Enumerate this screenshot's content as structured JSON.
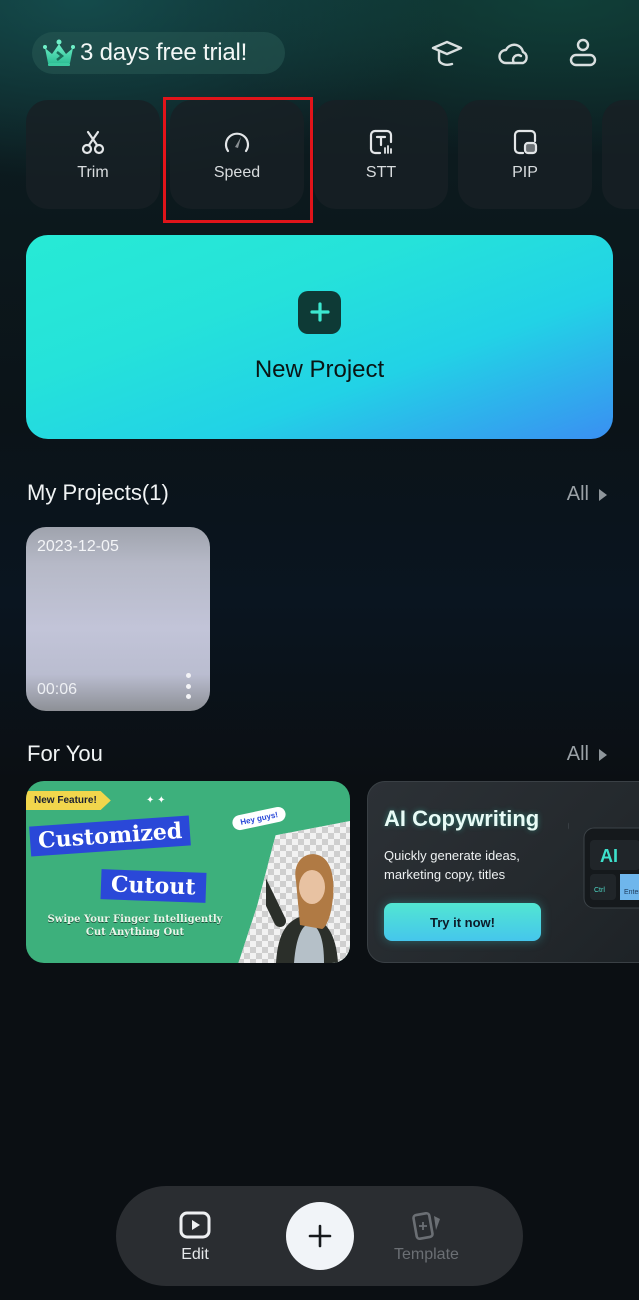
{
  "header": {
    "trial_label": "3 days free trial!",
    "icons": [
      "graduation-cap-icon",
      "cloud-icon",
      "user-icon"
    ]
  },
  "tools": [
    {
      "label": "Trim",
      "icon": "scissors-icon"
    },
    {
      "label": "Speed",
      "icon": "speedometer-icon",
      "highlighted": true
    },
    {
      "label": "STT",
      "icon": "speech-to-text-icon"
    },
    {
      "label": "PIP",
      "icon": "picture-in-picture-icon"
    }
  ],
  "new_project": {
    "label": "New Project",
    "icon": "plus-icon"
  },
  "my_projects": {
    "title": "My Projects(1)",
    "all_label": "All",
    "items": [
      {
        "date": "2023-12-05",
        "duration": "00:06"
      }
    ]
  },
  "for_you": {
    "title": "For You",
    "all_label": "All",
    "cards": [
      {
        "tag": "New Feature!",
        "title_line1": "Customized",
        "title_line2": "Cutout",
        "subtitle_line1": "Swipe Your Finger Intelligently",
        "subtitle_line2": "Cut Anything Out",
        "bubble": "Hey guys!"
      },
      {
        "title": "AI Copywriting",
        "description": "Quickly generate ideas, marketing copy, titles",
        "button_label": "Try it now!",
        "key_labels": [
          "AI",
          "Ctrl",
          "Enter"
        ]
      }
    ]
  },
  "bottom_nav": {
    "items": [
      {
        "label": "Edit",
        "icon": "play-square-icon",
        "active": true
      },
      {
        "label": "",
        "icon": "plus-icon"
      },
      {
        "label": "Template",
        "icon": "template-cards-icon",
        "active": false
      }
    ]
  },
  "colors": {
    "accent_cyan": "#27ead5",
    "accent_blue": "#3a8ff2",
    "highlight_red": "#e0141a",
    "background": "#0b0f13"
  }
}
